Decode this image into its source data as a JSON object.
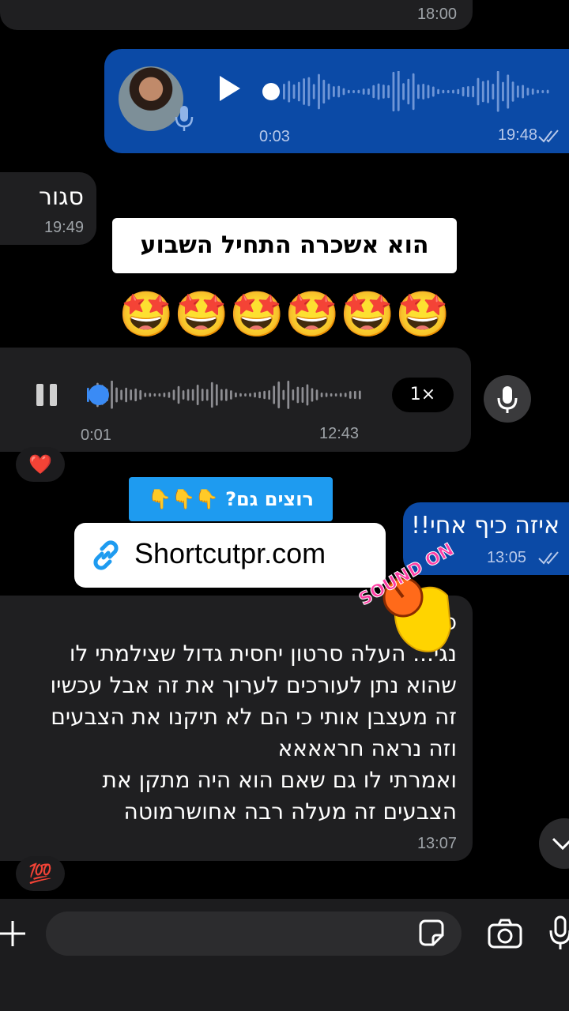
{
  "messages": {
    "top_partial": {
      "time": "18:00"
    },
    "voice_out": {
      "duration": "0:03",
      "time": "19:48"
    },
    "close": {
      "text": "סגור",
      "time": "19:49"
    },
    "voice_in": {
      "current": "0:01",
      "time": "12:43",
      "speed": "1×"
    },
    "wow": {
      "text": "איזה כיף אחי!!",
      "time": "13:05"
    },
    "long": {
      "lines": [
        "כ",
        "נגי... העלה סרטון יחסית גדול שצילמתי לו",
        "שהוא נתן לעורכים לערוך את זה אבל עכשיו",
        "זה מעצבן אותי כי הם לא תיקנו את הצבעים",
        "וזה נראה חראאאא",
        "ואמרתי לו גם שאם הוא היה מתקן את",
        "הצבעים זה מעלה רבה אחושרמוטה"
      ],
      "time": "13:07"
    }
  },
  "overlays": {
    "caption1": "הוא אשכרה התחיל השבוע",
    "emojis": [
      "🤩",
      "🤩",
      "🤩",
      "🤩",
      "🤩",
      "🤩"
    ],
    "blue_sticker": "רוצים גם? 👇👇👇",
    "link_url": "Shortcutpr.com",
    "sound_on": "SOUND ON"
  },
  "reactions": {
    "heart": "❤️",
    "hundred": "💯"
  },
  "input": {
    "placeholder": ""
  },
  "colors": {
    "outgoing": "#0b4aa6",
    "incoming": "#1f1f21",
    "accent": "#3a8bf5",
    "caption_bg": "#ffffff",
    "sticker_blue": "#1e9bf0"
  }
}
